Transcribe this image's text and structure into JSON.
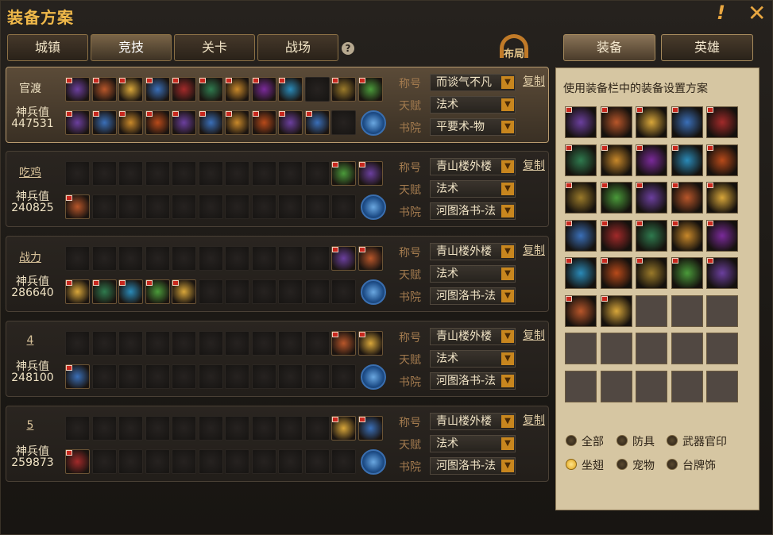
{
  "window": {
    "title": "装备方案"
  },
  "tabs": [
    {
      "label": "城镇",
      "active": false
    },
    {
      "label": "竞技",
      "active": true
    },
    {
      "label": "关卡",
      "active": false
    },
    {
      "label": "战场",
      "active": false
    }
  ],
  "help_icon": "?",
  "layout_button": "布局",
  "row_labels": {
    "title": "称号",
    "talent": "天赋",
    "academy": "书院",
    "power": "神兵值",
    "copy": "复制"
  },
  "plans": [
    {
      "name": "官渡",
      "power": "447531",
      "title": "而谈气不凡",
      "talent": "法术",
      "academy": "平要术-物",
      "active": true
    },
    {
      "name": "吃鸡",
      "power": "240825",
      "title": "青山楼外楼",
      "talent": "法术",
      "academy": "河图洛书-法",
      "active": false
    },
    {
      "name": "战力",
      "power": "286640",
      "title": "青山楼外楼",
      "talent": "法术",
      "academy": "河图洛书-法",
      "active": false
    },
    {
      "name": "4",
      "power": "248100",
      "title": "青山楼外楼",
      "talent": "法术",
      "academy": "河图洛书-法",
      "active": false
    },
    {
      "name": "5",
      "power": "259873",
      "title": "青山楼外楼",
      "talent": "法术",
      "academy": "河图洛书-法",
      "active": false
    }
  ],
  "right_tabs": [
    {
      "label": "装备",
      "active": true
    },
    {
      "label": "英雄",
      "active": false
    }
  ],
  "right_desc": "使用装备栏中的装备设置方案",
  "filters": [
    {
      "label": "全部",
      "selected": false
    },
    {
      "label": "防具",
      "selected": false
    },
    {
      "label": "武器官印",
      "selected": false
    },
    {
      "label": "坐翅",
      "selected": true
    },
    {
      "label": "宠物",
      "selected": false
    },
    {
      "label": "台牌饰",
      "selected": false
    }
  ],
  "colors": {
    "accent": "#f0b94a",
    "tab_active": "#7a6548",
    "panel": "#d6c6a2",
    "radio_on": "#e0a21a"
  }
}
